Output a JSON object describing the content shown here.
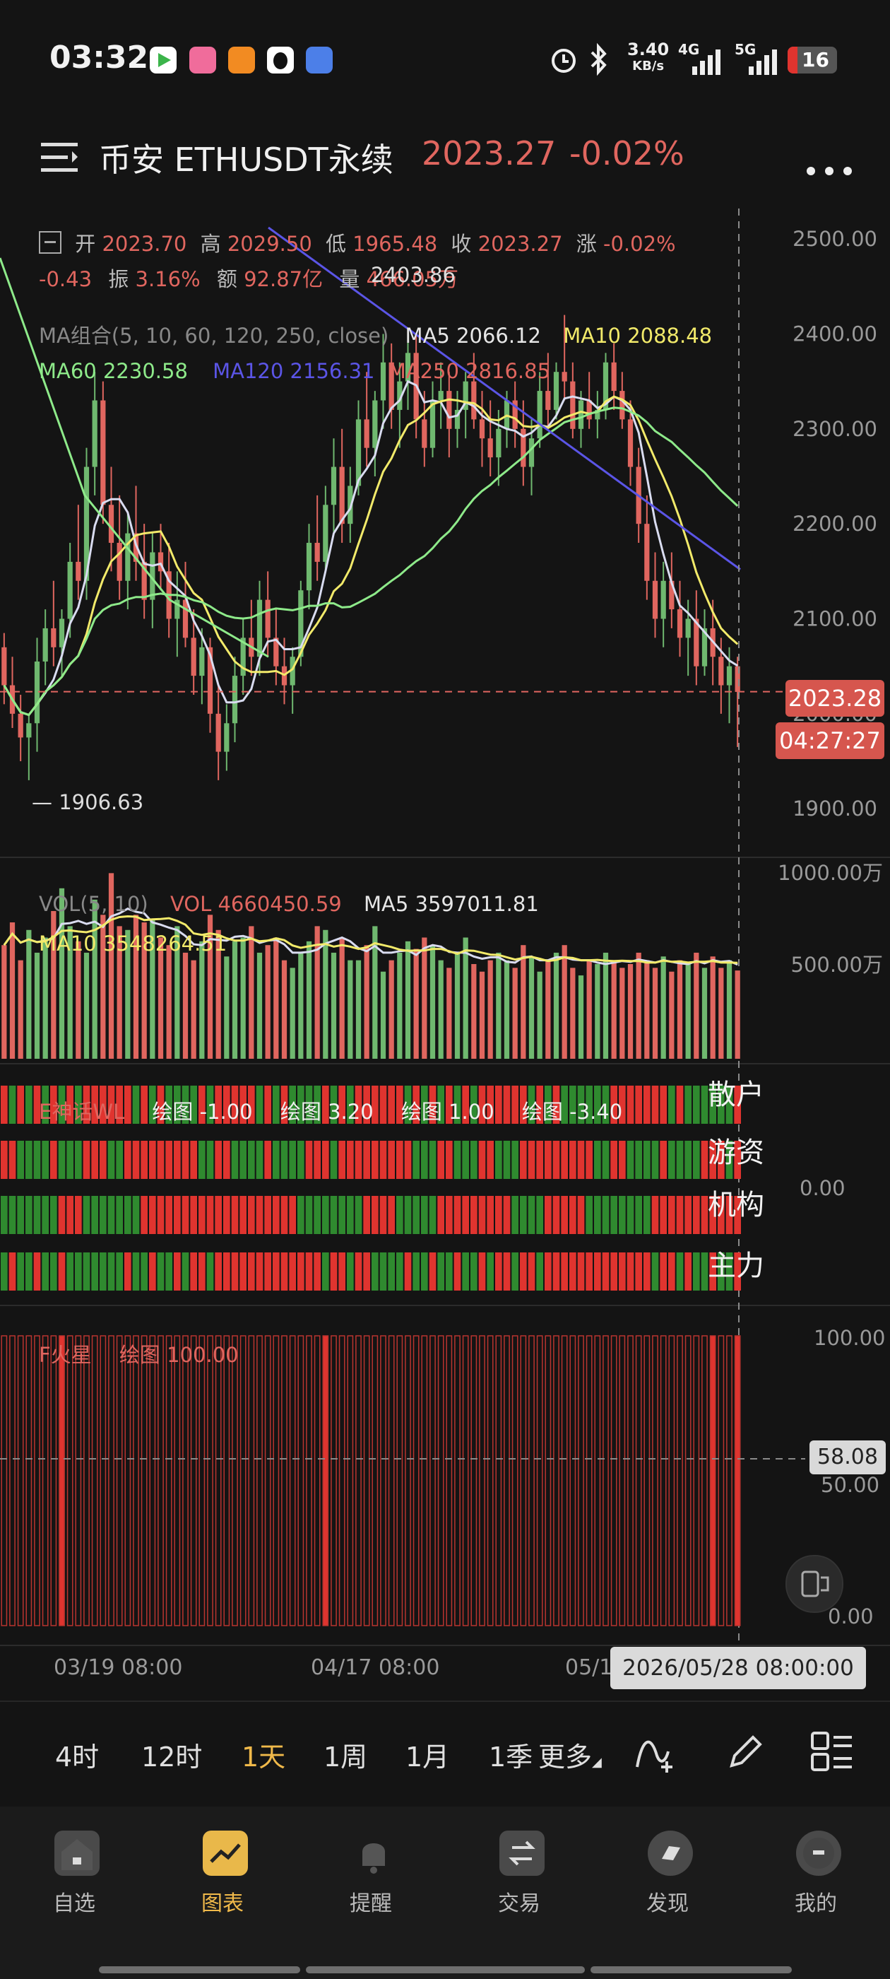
{
  "status_bar": {
    "time": "03:32",
    "net_speed": "3.40",
    "net_unit": "KB/s",
    "network_1": "4G",
    "network_2": "5G",
    "battery": "16",
    "icons": [
      "media-app-icon",
      "bilibili-icon",
      "orange-app-icon",
      "qq-icon",
      "browser-icon",
      "alarm-icon",
      "bluetooth-icon",
      "signal-icon",
      "signal-icon",
      "battery-icon"
    ]
  },
  "header": {
    "title": "币安 ETHUSDT永续",
    "price": "2023.27",
    "change": "-0.02%"
  },
  "ohlc": {
    "open_label": "开",
    "open": "2023.70",
    "high_label": "高",
    "high": "2029.50",
    "low_label": "低",
    "low": "1965.48",
    "close_label": "收",
    "close": "2023.27",
    "chg_label": "涨",
    "chg": "-0.02%",
    "chg_abs": "-0.43",
    "amp_label": "振",
    "amp": "3.16%",
    "amount_label": "额",
    "amount": "92.87亿",
    "volume_label": "量",
    "volume": "466.05万"
  },
  "ma_legend": {
    "title": "MA组合(5, 10, 60, 120, 250, close)",
    "ma5": "MA5 2066.12",
    "ma10": "MA10 2088.48",
    "ma60": "MA60 2230.58",
    "ma120": "MA120 2156.31",
    "ma250": "MA250 2816.85"
  },
  "colors": {
    "up": "#6fb86f",
    "down": "#e0665f",
    "ma5": "#d9dcf0",
    "ma10": "#f2ea6a",
    "ma60": "#8eea8a",
    "ma120": "#5b55e6",
    "bg": "#141414"
  },
  "chart_data": {
    "type": "candlestick",
    "price_axis": [
      "2500.00",
      "2400.00",
      "2300.00",
      "2200.00",
      "2100.00",
      "2000.00",
      "1900.00"
    ],
    "ylim": [
      1886,
      2512
    ],
    "annotations": {
      "high": "2403.86",
      "low": "— 1906.63"
    },
    "current_price_tag": "2023.28",
    "countdown_tag": "04:27:27",
    "date_labels": [
      "03/19 08:00",
      "04/17 08:00",
      "05/1"
    ],
    "crosshair_date": "2026/05/28 08:00:00",
    "ohlc_series": [
      [
        2070,
        2085,
        2010,
        2030
      ],
      [
        2030,
        2060,
        1985,
        2000
      ],
      [
        2000,
        2020,
        1950,
        1975
      ],
      [
        1975,
        2000,
        1930,
        1990
      ],
      [
        1990,
        2080,
        1960,
        2055
      ],
      [
        2055,
        2110,
        2030,
        2090
      ],
      [
        2090,
        2140,
        2050,
        2070
      ],
      [
        2070,
        2110,
        2040,
        2100
      ],
      [
        2100,
        2180,
        2080,
        2160
      ],
      [
        2160,
        2220,
        2120,
        2140
      ],
      [
        2140,
        2280,
        2120,
        2260
      ],
      [
        2260,
        2360,
        2230,
        2330
      ],
      [
        2330,
        2350,
        2200,
        2220
      ],
      [
        2220,
        2260,
        2150,
        2180
      ],
      [
        2180,
        2230,
        2120,
        2140
      ],
      [
        2140,
        2210,
        2110,
        2190
      ],
      [
        2190,
        2240,
        2140,
        2160
      ],
      [
        2160,
        2200,
        2100,
        2120
      ],
      [
        2120,
        2190,
        2090,
        2170
      ],
      [
        2170,
        2200,
        2130,
        2150
      ],
      [
        2150,
        2180,
        2080,
        2100
      ],
      [
        2100,
        2150,
        2060,
        2120
      ],
      [
        2120,
        2160,
        2070,
        2080
      ],
      [
        2080,
        2110,
        2020,
        2040
      ],
      [
        2040,
        2090,
        2010,
        2070
      ],
      [
        2070,
        2080,
        1980,
        2000
      ],
      [
        2000,
        2030,
        1930,
        1960
      ],
      [
        1960,
        2010,
        1940,
        1990
      ],
      [
        1990,
        2060,
        1970,
        2040
      ],
      [
        2040,
        2100,
        2020,
        2080
      ],
      [
        2080,
        2120,
        2040,
        2060
      ],
      [
        2060,
        2140,
        2040,
        2120
      ],
      [
        2120,
        2150,
        2060,
        2080
      ],
      [
        2080,
        2110,
        2030,
        2050
      ],
      [
        2050,
        2080,
        2010,
        2030
      ],
      [
        2030,
        2070,
        2000,
        2060
      ],
      [
        2060,
        2140,
        2050,
        2130
      ],
      [
        2130,
        2200,
        2110,
        2180
      ],
      [
        2180,
        2230,
        2140,
        2160
      ],
      [
        2160,
        2240,
        2150,
        2220
      ],
      [
        2220,
        2290,
        2190,
        2260
      ],
      [
        2260,
        2300,
        2180,
        2200
      ],
      [
        2200,
        2260,
        2180,
        2240
      ],
      [
        2240,
        2330,
        2230,
        2310
      ],
      [
        2310,
        2360,
        2260,
        2280
      ],
      [
        2280,
        2340,
        2250,
        2330
      ],
      [
        2330,
        2400,
        2300,
        2370
      ],
      [
        2370,
        2390,
        2300,
        2320
      ],
      [
        2320,
        2370,
        2280,
        2350
      ],
      [
        2350,
        2404,
        2320,
        2380
      ],
      [
        2380,
        2400,
        2290,
        2310
      ],
      [
        2310,
        2340,
        2260,
        2280
      ],
      [
        2280,
        2350,
        2270,
        2330
      ],
      [
        2330,
        2370,
        2300,
        2340
      ],
      [
        2340,
        2360,
        2270,
        2300
      ],
      [
        2300,
        2340,
        2280,
        2320
      ],
      [
        2320,
        2360,
        2290,
        2350
      ],
      [
        2350,
        2380,
        2300,
        2310
      ],
      [
        2310,
        2340,
        2260,
        2290
      ],
      [
        2290,
        2330,
        2250,
        2270
      ],
      [
        2270,
        2320,
        2240,
        2300
      ],
      [
        2300,
        2340,
        2280,
        2330
      ],
      [
        2330,
        2350,
        2280,
        2300
      ],
      [
        2300,
        2330,
        2240,
        2260
      ],
      [
        2260,
        2310,
        2230,
        2290
      ],
      [
        2290,
        2360,
        2280,
        2340
      ],
      [
        2340,
        2380,
        2300,
        2320
      ],
      [
        2320,
        2370,
        2310,
        2360
      ],
      [
        2360,
        2420,
        2330,
        2350
      ],
      [
        2350,
        2370,
        2290,
        2300
      ],
      [
        2300,
        2340,
        2280,
        2330
      ],
      [
        2330,
        2360,
        2300,
        2310
      ],
      [
        2310,
        2340,
        2290,
        2320
      ],
      [
        2320,
        2380,
        2310,
        2370
      ],
      [
        2370,
        2390,
        2320,
        2340
      ],
      [
        2340,
        2360,
        2300,
        2310
      ],
      [
        2310,
        2330,
        2240,
        2260
      ],
      [
        2260,
        2280,
        2180,
        2200
      ],
      [
        2200,
        2230,
        2120,
        2140
      ],
      [
        2140,
        2170,
        2080,
        2100
      ],
      [
        2100,
        2160,
        2070,
        2140
      ],
      [
        2140,
        2170,
        2090,
        2110
      ],
      [
        2110,
        2140,
        2060,
        2080
      ],
      [
        2080,
        2120,
        2040,
        2100
      ],
      [
        2100,
        2130,
        2030,
        2050
      ],
      [
        2050,
        2110,
        2040,
        2090
      ],
      [
        2090,
        2120,
        2030,
        2060
      ],
      [
        2060,
        2080,
        2000,
        2030
      ],
      [
        2030,
        2070,
        1990,
        2050
      ],
      [
        2050,
        2060,
        1965,
        2023
      ]
    ],
    "volume_axis": [
      "1000.00万",
      "500.00万"
    ],
    "volume_legend": {
      "title": "VOL(5, 10)",
      "vol": "VOL 4660450.59",
      "ma5": "MA5 3597011.81",
      "ma10": "MA10 3548264.51"
    },
    "volume_ylim": [
      0,
      1000
    ],
    "volumes": [
      600,
      720,
      520,
      680,
      560,
      640,
      780,
      900,
      700,
      620,
      560,
      840,
      760,
      980,
      700,
      680,
      760,
      720,
      740,
      640,
      600,
      700,
      560,
      520,
      620,
      760,
      680,
      540,
      620,
      640,
      700,
      560,
      600,
      640,
      520,
      480,
      560,
      620,
      700,
      680,
      560,
      640,
      520,
      520,
      600,
      700,
      460,
      520,
      560,
      620,
      580,
      640,
      600,
      520,
      480,
      560,
      640,
      500,
      460,
      520,
      560,
      520,
      480,
      600,
      540,
      460,
      520,
      560,
      600,
      480,
      440,
      520,
      500,
      560,
      520,
      480,
      500,
      560,
      520,
      480,
      540,
      460,
      520,
      500,
      560,
      480,
      540,
      480,
      520,
      466
    ],
    "indicator_e": {
      "title": "E神话WL",
      "values": [
        "绘图 -1.00",
        "绘图 3.20",
        "绘图 1.00",
        "绘图 -3.40"
      ],
      "row_labels": [
        "散户",
        "游资",
        "机构",
        "主力"
      ],
      "axis": "0.00"
    },
    "indicator_f": {
      "title": "F火星",
      "value": "绘图 100.00",
      "axis_top": "100.00",
      "axis_mid": "50.00",
      "axis_bottom": "0.00",
      "crosshair_tag": "58.08"
    }
  },
  "timeframes": [
    "4时",
    "12时",
    "1天",
    "1周",
    "1月",
    "1季",
    "更多"
  ],
  "active_timeframe": "1天",
  "bottom_nav": [
    {
      "label": "自选",
      "icon": "watchlist-icon"
    },
    {
      "label": "图表",
      "icon": "chart-icon"
    },
    {
      "label": "提醒",
      "icon": "bell-icon"
    },
    {
      "label": "交易",
      "icon": "trade-icon"
    },
    {
      "label": "发现",
      "icon": "discover-icon"
    },
    {
      "label": "我的",
      "icon": "profile-icon"
    }
  ]
}
